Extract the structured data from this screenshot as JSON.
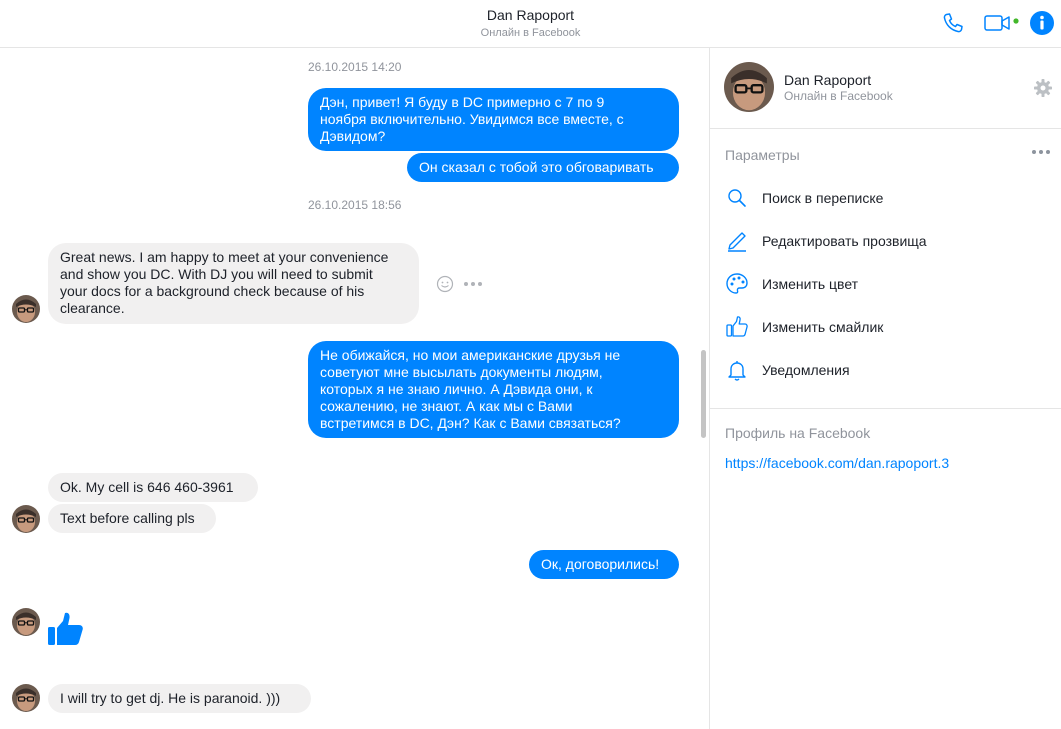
{
  "header": {
    "title": "Dan Rapoport",
    "subtitle": "Онлайн в Facebook",
    "icons": [
      "phone-icon",
      "video-icon",
      "info-icon"
    ],
    "accent_color": "#0084ff",
    "online_color": "#42b72a"
  },
  "chat": {
    "timestamps": [
      "26.10.2015 14:20",
      "26.10.2015 18:56"
    ],
    "messages": [
      {
        "from": "me",
        "text": "Дэн, привет! Я буду в DC примерно с 7 по 9\nноября включительно. Увидимся все вместе, с\nДэвидом?"
      },
      {
        "from": "me",
        "text": "Он сказал с тобой это обговаривать"
      },
      {
        "from": "dan",
        "text": "Great news. I am happy to meet at your convenience\nand show you DC.  With DJ you will need to submit\nyour docs for a background check because of his\nclearance."
      },
      {
        "from": "me",
        "text": "Не обижайся, но мои американские друзья не\nсоветуют мне высылать документы людям,\nкоторых я не знаю лично. А Дэвида они, к\nсожалению, не знают. А как мы с Вами\nвстретимся в DC, Дэн? Как с Вами связаться?"
      },
      {
        "from": "dan",
        "text": "Ok. My cell is 646 460-3961"
      },
      {
        "from": "dan",
        "text": "Text before calling pls"
      },
      {
        "from": "me",
        "text": "Ок, договорились!"
      },
      {
        "from": "dan",
        "sticker": "thumbs-up-icon"
      },
      {
        "from": "dan",
        "text": "I will try to get dj.   He is paranoid. )))"
      }
    ],
    "bubble_colors": {
      "outgoing": "#0084ff",
      "incoming": "#f1f0f0"
    }
  },
  "panel": {
    "name": "Dan Rapoport",
    "status": "Онлайн в Facebook",
    "settings_label": "Параметры",
    "menu": [
      {
        "icon": "search-icon",
        "label": "Поиск в переписке"
      },
      {
        "icon": "pencil-icon",
        "label": "Редактировать прозвища"
      },
      {
        "icon": "palette-icon",
        "label": "Изменить цвет"
      },
      {
        "icon": "thumbs-up-icon",
        "label": "Изменить смайлик"
      },
      {
        "icon": "bell-icon",
        "label": "Уведомления"
      }
    ],
    "profile_label": "Профиль на Facebook",
    "profile_link": "https://facebook.com/dan.rapoport.3"
  }
}
